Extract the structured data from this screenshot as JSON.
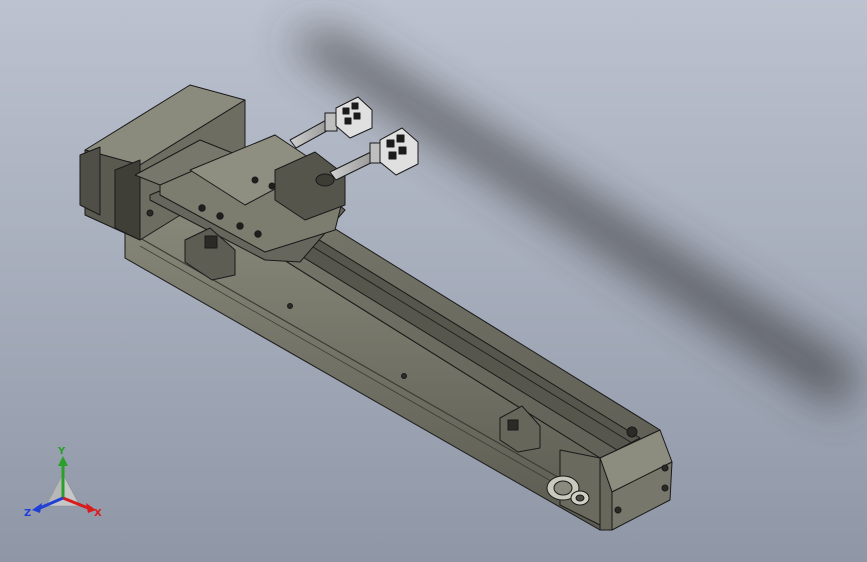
{
  "viewport": {
    "background_top": "#bcc2cf",
    "background_bottom": "#8f97a7"
  },
  "model": {
    "body_color": "#6f6f63",
    "body_dark": "#4d4d44",
    "body_light": "#8b8b7d",
    "edge_color": "#1a1a1a"
  },
  "triad": {
    "x_label": "X",
    "y_label": "Y",
    "z_label": "Z",
    "x_color": "#d81b1b",
    "y_color": "#2aa02a",
    "z_color": "#1f3fd6"
  }
}
